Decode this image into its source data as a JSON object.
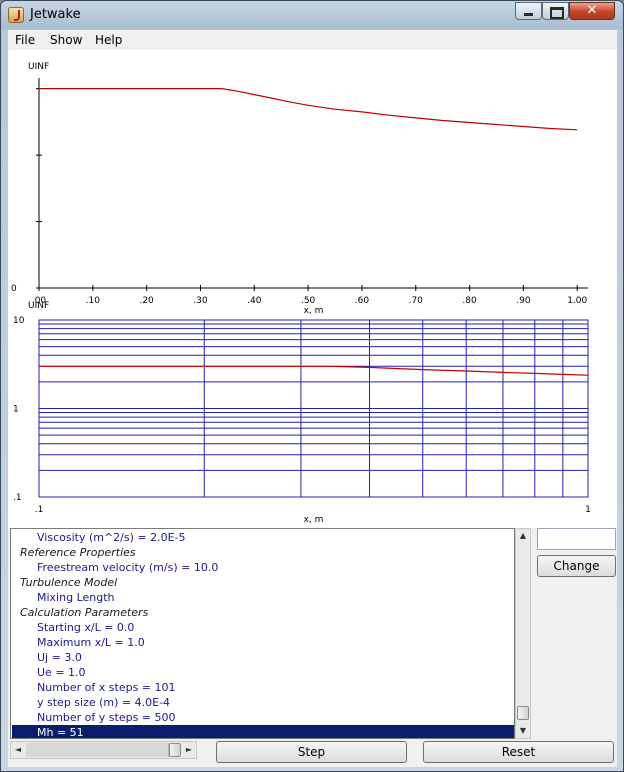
{
  "window": {
    "title": "Jetwake",
    "close_glyph": "✕"
  },
  "menu": {
    "items": [
      "File",
      "Show",
      "Help"
    ]
  },
  "chart_data": [
    {
      "type": "line",
      "ylabel": "UINF",
      "xlabel": "x, m",
      "xlim": [
        0,
        1.02
      ],
      "ylim": [
        0,
        3.1
      ],
      "y_ticks": [
        0,
        1,
        2,
        3
      ],
      "y_tick_labels": [
        "0"
      ],
      "x_ticks": [
        0,
        0.1,
        0.2,
        0.3,
        0.4,
        0.5,
        0.6,
        0.7,
        0.8,
        0.9,
        1.0
      ],
      "x_tick_labels": [
        ".00",
        ".10",
        ".20",
        ".30",
        ".40",
        ".50",
        ".60",
        ".70",
        ".80",
        ".90",
        "1.00"
      ],
      "grid": false,
      "series": [
        {
          "color": "#c00000",
          "x": [
            0.0,
            0.1,
            0.2,
            0.3,
            0.34,
            0.37,
            0.4,
            0.43,
            0.46,
            0.5,
            0.55,
            0.6,
            0.65,
            0.7,
            0.75,
            0.8,
            0.85,
            0.9,
            0.95,
            1.0
          ],
          "y": [
            3.0,
            3.0,
            3.0,
            3.0,
            3.0,
            2.96,
            2.91,
            2.86,
            2.81,
            2.75,
            2.69,
            2.65,
            2.6,
            2.56,
            2.52,
            2.49,
            2.46,
            2.43,
            2.4,
            2.38
          ]
        }
      ]
    },
    {
      "type": "line",
      "ylabel": "UINF",
      "xlabel": "x, m",
      "xscale": "log",
      "yscale": "log",
      "xlim": [
        0.1,
        1
      ],
      "ylim": [
        0.1,
        10
      ],
      "x_tick_labels": [
        ".1",
        "1"
      ],
      "y_tick_labels": [
        "10",
        "1",
        ".1"
      ],
      "grid": true,
      "series": [
        {
          "color": "#c00000",
          "x": [
            0.1,
            0.2,
            0.34,
            0.4,
            0.5,
            0.6,
            0.7,
            0.8,
            0.9,
            1.0
          ],
          "y": [
            3.0,
            3.0,
            3.0,
            2.91,
            2.75,
            2.65,
            2.56,
            2.49,
            2.43,
            2.38
          ]
        }
      ]
    }
  ],
  "properties": {
    "rows": [
      {
        "type": "prop",
        "text": "Viscosity (m^2/s) = 2.0E-5"
      },
      {
        "type": "cat",
        "text": "Reference Properties"
      },
      {
        "type": "prop",
        "text": "Freestream velocity (m/s) = 10.0"
      },
      {
        "type": "cat",
        "text": "Turbulence Model"
      },
      {
        "type": "prop",
        "text": "Mixing Length"
      },
      {
        "type": "cat",
        "text": "Calculation Parameters"
      },
      {
        "type": "prop",
        "text": "Starting x/L = 0.0"
      },
      {
        "type": "prop",
        "text": "Maximum x/L = 1.0"
      },
      {
        "type": "prop",
        "text": "Uj = 3.0"
      },
      {
        "type": "prop",
        "text": "Ue = 1.0"
      },
      {
        "type": "prop",
        "text": "Number of x steps = 101"
      },
      {
        "type": "prop",
        "text": "y step size (m) = 4.0E-4"
      },
      {
        "type": "prop",
        "text": "Number of y steps = 500"
      },
      {
        "type": "sel",
        "text": "Mh = 51"
      }
    ]
  },
  "scroll_arrows": {
    "up": "▲",
    "down": "▼",
    "left": "◄",
    "right": "►"
  },
  "side": {
    "input_value": "",
    "change_label": "Change"
  },
  "buttons": {
    "step_label": "Step",
    "reset_label": "Reset"
  }
}
